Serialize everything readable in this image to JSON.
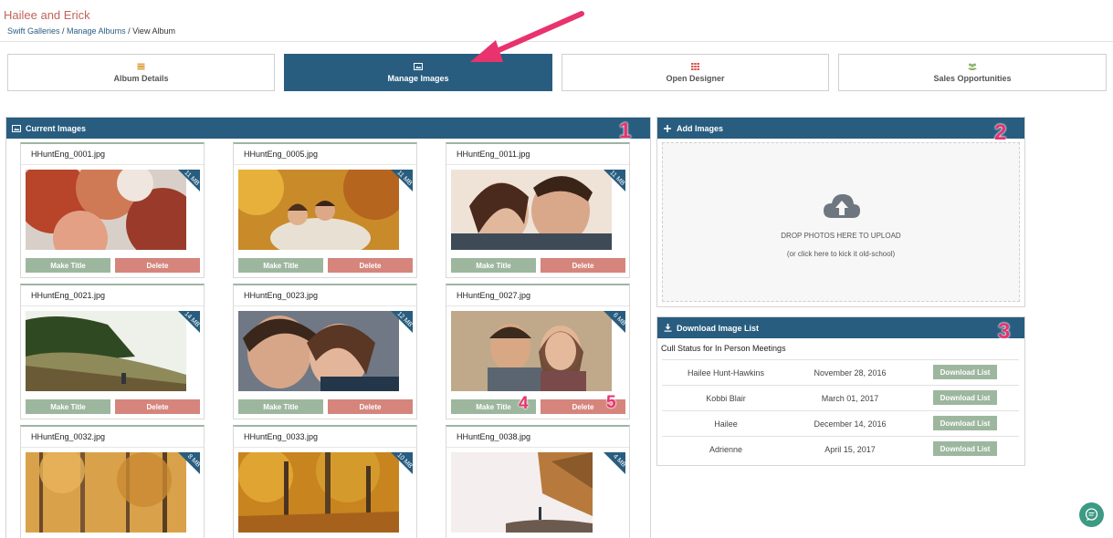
{
  "header": {
    "album_title": "Hailee and Erick",
    "breadcrumb": {
      "item1": "Swift Galleries",
      "sep1": " / ",
      "item2": "Manage Albums",
      "sep2": " / ",
      "current": "View Album"
    }
  },
  "tabs": [
    {
      "label": "Album Details",
      "icon": "album-stack-icon",
      "active": false
    },
    {
      "label": "Manage Images",
      "icon": "image-icon",
      "active": true
    },
    {
      "label": "Open Designer",
      "icon": "grid-icon",
      "active": false
    },
    {
      "label": "Sales Opportunities",
      "icon": "people-icon",
      "active": false
    }
  ],
  "current_images": {
    "title": "Current Images",
    "make_title_label": "Make Title",
    "delete_label": "Delete",
    "cards": [
      {
        "filename": "HHuntEng_0001.jpg",
        "size": "11 MB"
      },
      {
        "filename": "HHuntEng_0005.jpg",
        "size": "11 MB"
      },
      {
        "filename": "HHuntEng_0011.jpg",
        "size": "11 MB"
      },
      {
        "filename": "HHuntEng_0021.jpg",
        "size": "14 MB"
      },
      {
        "filename": "HHuntEng_0023.jpg",
        "size": "12 MB"
      },
      {
        "filename": "HHuntEng_0027.jpg",
        "size": "6 MB"
      },
      {
        "filename": "HHuntEng_0032.jpg",
        "size": "8 MB"
      },
      {
        "filename": "HHuntEng_0033.jpg",
        "size": "10 MB"
      },
      {
        "filename": "HHuntEng_0038.jpg",
        "size": "4 MB"
      }
    ]
  },
  "add_images": {
    "title": "Add Images",
    "drop_text": "DROP PHOTOS HERE TO UPLOAD",
    "alt_text": "(or click here to kick it old-school)"
  },
  "download_list": {
    "title": "Download Image List",
    "caption": "Cull Status for In Person Meetings",
    "button_label": "Download List",
    "rows": [
      {
        "name": "Hailee Hunt-Hawkins",
        "date": "November 28, 2016"
      },
      {
        "name": "Kobbi Blair",
        "date": "March 01, 2017"
      },
      {
        "name": "Hailee",
        "date": "December 14, 2016"
      },
      {
        "name": "Adrienne",
        "date": "April 15, 2017"
      }
    ]
  },
  "annotations": [
    "1",
    "2",
    "3",
    "4",
    "5"
  ],
  "colors": {
    "primary": "#285d7f",
    "make_title": "#9db79e",
    "delete": "#d5857c",
    "title_text": "#c2645a",
    "annotation": "#e8336e",
    "chat": "#3d9a84"
  }
}
